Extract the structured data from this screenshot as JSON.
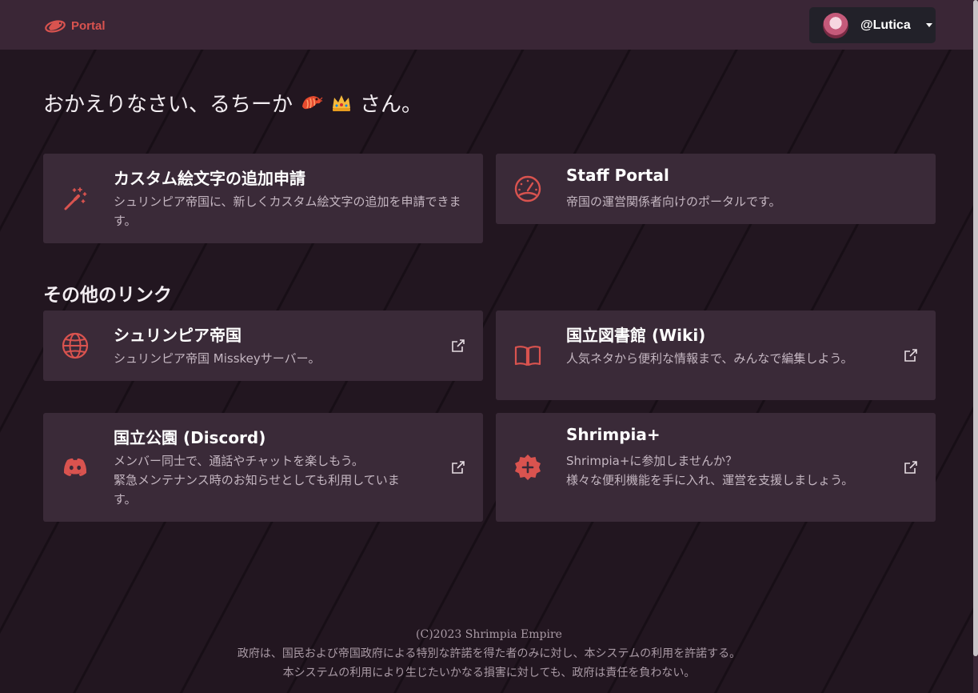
{
  "nav": {
    "brand": "Portal",
    "user": "@Lutica"
  },
  "greeting": {
    "prefix": "おかえりなさい、るちーか",
    "suffix": "さん。"
  },
  "cards": {
    "emoji": {
      "title": "カスタム絵文字の追加申請",
      "desc": "シュリンピア帝国に、新しくカスタム絵文字の追加を申請できます。"
    },
    "staff": {
      "title": "Staff Portal",
      "desc": "帝国の運営関係者向けのポータルです。"
    }
  },
  "links": {
    "heading": "その他のリンク",
    "empire": {
      "title": "シュリンピア帝国",
      "desc": "シュリンピア帝国 Misskeyサーバー。"
    },
    "wiki": {
      "title": "国立図書館 (Wiki)",
      "desc": "人気ネタから便利な情報まで、みんなで編集しよう。"
    },
    "discord": {
      "title": "国立公園 (Discord)",
      "desc_line1": "メンバー同士で、通話やチャットを楽しもう。",
      "desc_line2": "緊急メンテナンス時のお知らせとしても利用しています。"
    },
    "plus": {
      "title": "Shrimpia+",
      "desc_line1": "Shrimpia+に参加しませんか？",
      "desc_line2": "様々な便利機能を手に入れ、運営を支援しましょう。"
    }
  },
  "footer": {
    "line1": "(C)2023 Shrimpia Empire",
    "line2": "政府は、国民および帝国政府による特別な許諾を得た者のみに対し、本システムの利用を許諾する。",
    "line3": "本システムの利用により生じたいかなる損害に対しても、政府は責任を負わない。"
  },
  "colors": {
    "accent": "#d9534f",
    "card": "#3a2a38",
    "navbar": "#3a2636",
    "background": "#221620"
  }
}
